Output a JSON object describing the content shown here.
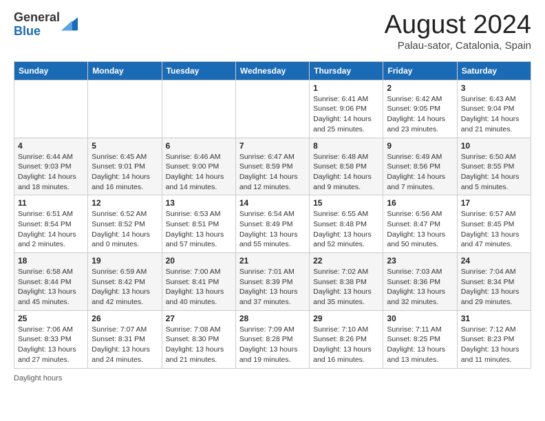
{
  "header": {
    "logo": {
      "general": "General",
      "blue": "Blue"
    },
    "title": "August 2024",
    "location": "Palau-sator, Catalonia, Spain"
  },
  "calendar": {
    "headers": [
      "Sunday",
      "Monday",
      "Tuesday",
      "Wednesday",
      "Thursday",
      "Friday",
      "Saturday"
    ],
    "weeks": [
      [
        {
          "day": "",
          "info": ""
        },
        {
          "day": "",
          "info": ""
        },
        {
          "day": "",
          "info": ""
        },
        {
          "day": "",
          "info": ""
        },
        {
          "day": "1",
          "sunrise": "6:41 AM",
          "sunset": "9:06 PM",
          "daylight": "14 hours and 25 minutes."
        },
        {
          "day": "2",
          "sunrise": "6:42 AM",
          "sunset": "9:05 PM",
          "daylight": "14 hours and 23 minutes."
        },
        {
          "day": "3",
          "sunrise": "6:43 AM",
          "sunset": "9:04 PM",
          "daylight": "14 hours and 21 minutes."
        }
      ],
      [
        {
          "day": "4",
          "sunrise": "6:44 AM",
          "sunset": "9:03 PM",
          "daylight": "14 hours and 18 minutes."
        },
        {
          "day": "5",
          "sunrise": "6:45 AM",
          "sunset": "9:01 PM",
          "daylight": "14 hours and 16 minutes."
        },
        {
          "day": "6",
          "sunrise": "6:46 AM",
          "sunset": "9:00 PM",
          "daylight": "14 hours and 14 minutes."
        },
        {
          "day": "7",
          "sunrise": "6:47 AM",
          "sunset": "8:59 PM",
          "daylight": "14 hours and 12 minutes."
        },
        {
          "day": "8",
          "sunrise": "6:48 AM",
          "sunset": "8:58 PM",
          "daylight": "14 hours and 9 minutes."
        },
        {
          "day": "9",
          "sunrise": "6:49 AM",
          "sunset": "8:56 PM",
          "daylight": "14 hours and 7 minutes."
        },
        {
          "day": "10",
          "sunrise": "6:50 AM",
          "sunset": "8:55 PM",
          "daylight": "14 hours and 5 minutes."
        }
      ],
      [
        {
          "day": "11",
          "sunrise": "6:51 AM",
          "sunset": "8:54 PM",
          "daylight": "14 hours and 2 minutes."
        },
        {
          "day": "12",
          "sunrise": "6:52 AM",
          "sunset": "8:52 PM",
          "daylight": "14 hours and 0 minutes."
        },
        {
          "day": "13",
          "sunrise": "6:53 AM",
          "sunset": "8:51 PM",
          "daylight": "13 hours and 57 minutes."
        },
        {
          "day": "14",
          "sunrise": "6:54 AM",
          "sunset": "8:49 PM",
          "daylight": "13 hours and 55 minutes."
        },
        {
          "day": "15",
          "sunrise": "6:55 AM",
          "sunset": "8:48 PM",
          "daylight": "13 hours and 52 minutes."
        },
        {
          "day": "16",
          "sunrise": "6:56 AM",
          "sunset": "8:47 PM",
          "daylight": "13 hours and 50 minutes."
        },
        {
          "day": "17",
          "sunrise": "6:57 AM",
          "sunset": "8:45 PM",
          "daylight": "13 hours and 47 minutes."
        }
      ],
      [
        {
          "day": "18",
          "sunrise": "6:58 AM",
          "sunset": "8:44 PM",
          "daylight": "13 hours and 45 minutes."
        },
        {
          "day": "19",
          "sunrise": "6:59 AM",
          "sunset": "8:42 PM",
          "daylight": "13 hours and 42 minutes."
        },
        {
          "day": "20",
          "sunrise": "7:00 AM",
          "sunset": "8:41 PM",
          "daylight": "13 hours and 40 minutes."
        },
        {
          "day": "21",
          "sunrise": "7:01 AM",
          "sunset": "8:39 PM",
          "daylight": "13 hours and 37 minutes."
        },
        {
          "day": "22",
          "sunrise": "7:02 AM",
          "sunset": "8:38 PM",
          "daylight": "13 hours and 35 minutes."
        },
        {
          "day": "23",
          "sunrise": "7:03 AM",
          "sunset": "8:36 PM",
          "daylight": "13 hours and 32 minutes."
        },
        {
          "day": "24",
          "sunrise": "7:04 AM",
          "sunset": "8:34 PM",
          "daylight": "13 hours and 29 minutes."
        }
      ],
      [
        {
          "day": "25",
          "sunrise": "7:06 AM",
          "sunset": "8:33 PM",
          "daylight": "13 hours and 27 minutes."
        },
        {
          "day": "26",
          "sunrise": "7:07 AM",
          "sunset": "8:31 PM",
          "daylight": "13 hours and 24 minutes."
        },
        {
          "day": "27",
          "sunrise": "7:08 AM",
          "sunset": "8:30 PM",
          "daylight": "13 hours and 21 minutes."
        },
        {
          "day": "28",
          "sunrise": "7:09 AM",
          "sunset": "8:28 PM",
          "daylight": "13 hours and 19 minutes."
        },
        {
          "day": "29",
          "sunrise": "7:10 AM",
          "sunset": "8:26 PM",
          "daylight": "13 hours and 16 minutes."
        },
        {
          "day": "30",
          "sunrise": "7:11 AM",
          "sunset": "8:25 PM",
          "daylight": "13 hours and 13 minutes."
        },
        {
          "day": "31",
          "sunrise": "7:12 AM",
          "sunset": "8:23 PM",
          "daylight": "13 hours and 11 minutes."
        }
      ]
    ]
  },
  "footer": {
    "daylight_label": "Daylight hours"
  },
  "colors": {
    "header_bg": "#1a6ab5",
    "accent": "#1a6ab5"
  }
}
